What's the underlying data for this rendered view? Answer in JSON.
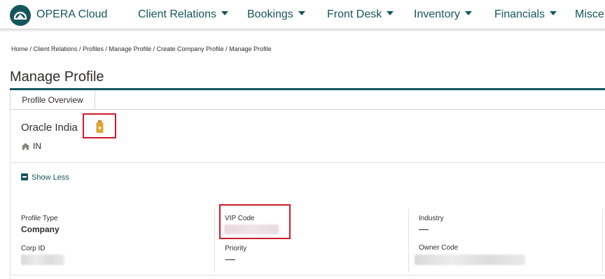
{
  "brand": {
    "name": "OPERA Cloud"
  },
  "nav": {
    "items": [
      {
        "label": "Client Relations"
      },
      {
        "label": "Bookings"
      },
      {
        "label": "Front Desk"
      },
      {
        "label": "Inventory"
      },
      {
        "label": "Financials"
      },
      {
        "label": "Misce"
      }
    ]
  },
  "breadcrumb": "Home / Client Relations / Profiles / Manage Profile / Create Company Profile / Manage Profile",
  "page": {
    "title": "Manage Profile"
  },
  "tabs": [
    {
      "label": "Profile Overview"
    }
  ],
  "profile": {
    "name": "Oracle India",
    "country": "IN",
    "vip_icon": "vip-badge-icon",
    "home_icon": "home-icon"
  },
  "toggle": {
    "label": "Show Less"
  },
  "fields": {
    "profile_type": {
      "label": "Profile Type",
      "value": "Company"
    },
    "corp_id": {
      "label": "Corp ID"
    },
    "vip_code": {
      "label": "VIP Code"
    },
    "priority": {
      "label": "Priority"
    },
    "industry": {
      "label": "Industry"
    },
    "owner_code": {
      "label": "Owner Code"
    }
  },
  "colors": {
    "primary": "#15565c",
    "highlight": "#d11a2a",
    "vip_badge": "#e0a534"
  }
}
